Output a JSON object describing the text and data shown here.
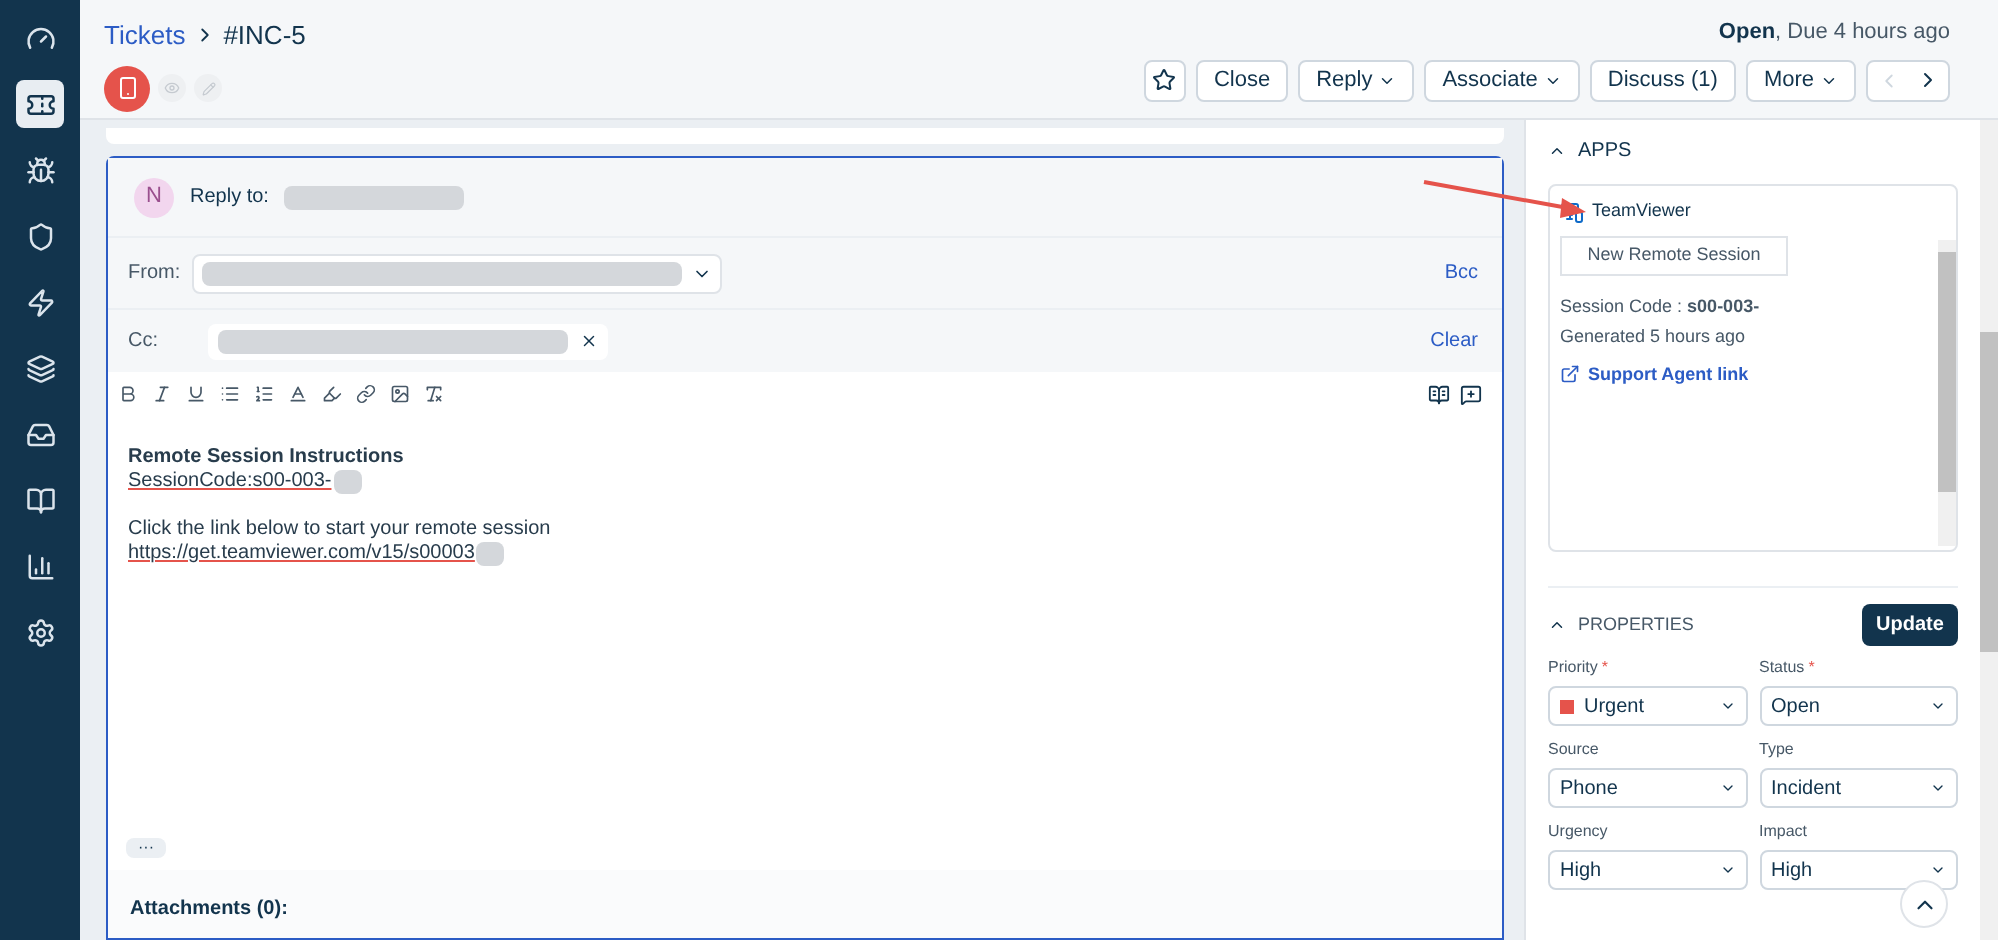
{
  "nav": [
    {
      "kind": "dashboard",
      "selected": false
    },
    {
      "kind": "tickets",
      "selected": true
    },
    {
      "kind": "problems",
      "selected": false
    },
    {
      "kind": "changes",
      "selected": false
    },
    {
      "kind": "releases",
      "selected": false
    },
    {
      "kind": "assets",
      "selected": false
    },
    {
      "kind": "inbox",
      "selected": false
    },
    {
      "kind": "solutions",
      "selected": false
    },
    {
      "kind": "reports",
      "selected": false
    },
    {
      "kind": "settings",
      "selected": false
    }
  ],
  "header": {
    "breadcrumb": "Tickets",
    "ticket_id": "#INC-5",
    "status": "Open",
    "due": ", Due 4 hours ago",
    "actions": [
      {
        "label": "Close",
        "dropdown": false
      },
      {
        "label": "Reply",
        "dropdown": true
      },
      {
        "label": "Associate",
        "dropdown": true
      },
      {
        "label": "Discuss (1)",
        "dropdown": false
      },
      {
        "label": "More",
        "dropdown": true
      }
    ]
  },
  "reply": {
    "avatar": "N",
    "reply_to": "Reply to:",
    "from_label": "From:",
    "bcc": "Bcc",
    "cc_label": "Cc:",
    "clear": "Clear",
    "body": {
      "heading": "Remote Session Instructions",
      "code_line": "SessionCode:s00-003-",
      "instruction": "Click the link below to start your remote session",
      "link": "https://get.teamviewer.com/v15/s00003"
    },
    "more": "···",
    "attachments": "Attachments (0):"
  },
  "apps": {
    "title": "APPS",
    "app_name": "TeamViewer",
    "new_session": "New Remote Session",
    "session_code": "Session Code : **s00-003-**",
    "generated": "Generated 5 hours ago",
    "agent_link": "Support Agent link"
  },
  "properties": {
    "title": "PROPERTIES",
    "update": "Update",
    "fields": [
      {
        "label": "Priority",
        "required_mark": "*",
        "value": "Urgent",
        "color": "#e5534b"
      },
      {
        "label": "Status",
        "required_mark": "*",
        "value": "Open"
      },
      {
        "label": "Source",
        "value": "Phone"
      },
      {
        "label": "Type",
        "value": "Incident"
      },
      {
        "label": "Urgency",
        "value": "High"
      },
      {
        "label": "Impact",
        "value": "High"
      }
    ]
  }
}
